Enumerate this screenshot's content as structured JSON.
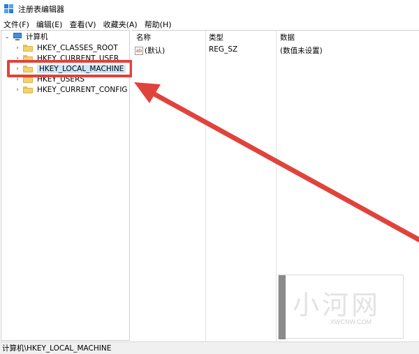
{
  "window": {
    "title": "注册表编辑器"
  },
  "menu": [
    "文件(F)",
    "编辑(E)",
    "查看(V)",
    "收藏夹(A)",
    "帮助(H)"
  ],
  "tree": {
    "root": "计算机",
    "items": [
      {
        "label": "HKEY_CLASSES_ROOT"
      },
      {
        "label": "HKEY_CURRENT_USER"
      },
      {
        "label": "HKEY_LOCAL_MACHINE",
        "selected": true
      },
      {
        "label": "HKEY_USERS"
      },
      {
        "label": "HKEY_CURRENT_CONFIG"
      }
    ]
  },
  "list": {
    "columns": [
      "名称",
      "类型",
      "数据"
    ],
    "rows": [
      {
        "icon": "ab",
        "name": "(默认)",
        "type": "REG_SZ",
        "data": "(数值未设置)"
      }
    ]
  },
  "status": {
    "path": "计算机\\HKEY_LOCAL_MACHINE"
  },
  "annotation": {
    "color": "#e0433b"
  },
  "watermark": {
    "big": "小河网",
    "small": "XWCNW.COM"
  }
}
